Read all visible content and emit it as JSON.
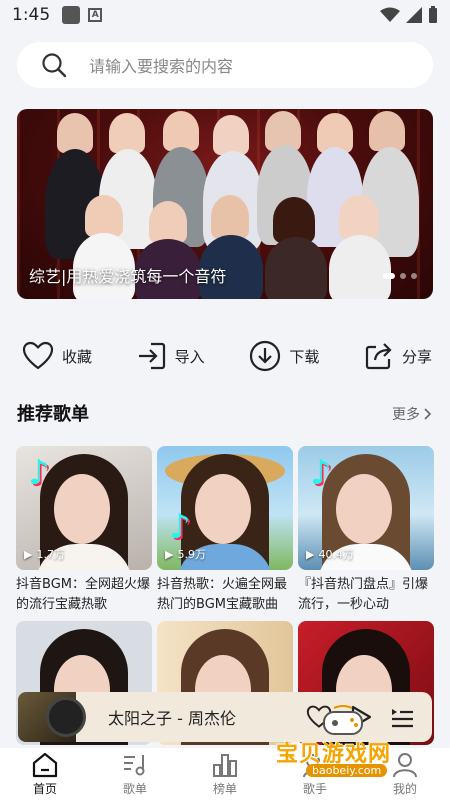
{
  "status_bar": {
    "time": "1:45"
  },
  "search": {
    "placeholder": "请输入要搜索的内容"
  },
  "banner": {
    "caption": "综艺|用热爱浇筑每一个音符"
  },
  "actions": [
    {
      "label": "收藏",
      "icon": "heart-icon"
    },
    {
      "label": "导入",
      "icon": "import-icon"
    },
    {
      "label": "下载",
      "icon": "download-icon"
    },
    {
      "label": "分享",
      "icon": "share-icon"
    }
  ],
  "section": {
    "title": "推荐歌单",
    "more": "更多"
  },
  "playlists": [
    {
      "plays": "1.7万",
      "title": "抖音BGM：全网超火爆的流行宝藏热歌"
    },
    {
      "plays": "5.9万",
      "title": "抖音热歌：火遍全网最热门的BGM宝藏歌曲"
    },
    {
      "plays": "40.4万",
      "title": "『抖音热门盘点』引爆流行，一秒心动"
    }
  ],
  "player": {
    "song": "太阳之子 - 周杰伦"
  },
  "nav": [
    {
      "label": "首页",
      "icon": "home-icon",
      "active": true
    },
    {
      "label": "歌单",
      "icon": "music-note-icon"
    },
    {
      "label": "榜单",
      "icon": "chart-icon"
    },
    {
      "label": "歌手",
      "icon": "singer-icon"
    },
    {
      "label": "我的",
      "icon": "profile-icon"
    }
  ],
  "watermark": {
    "text": "宝贝游戏网",
    "url": "baobeiy.com"
  }
}
